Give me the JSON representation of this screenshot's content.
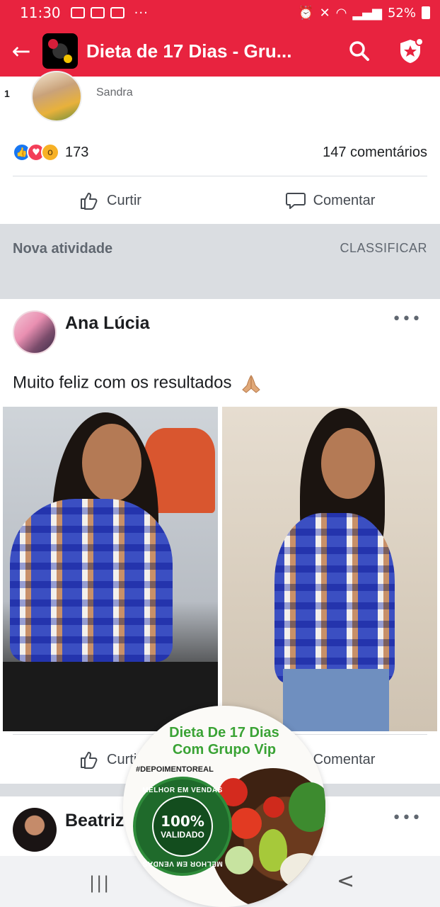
{
  "status_bar": {
    "time": "11:30",
    "battery": "52%"
  },
  "app_bar": {
    "title": "Dieta de 17 Dias - Gru..."
  },
  "previous_post": {
    "rank": "1",
    "author": "Sandra",
    "reaction_count": "173",
    "comments": "147 comentários",
    "like_label": "Curtir",
    "comment_label": "Comentar"
  },
  "section": {
    "title": "Nova atividade",
    "sort_label": "CLASSIFICAR"
  },
  "post": {
    "author": "Ana Lúcia",
    "text": "Muito feliz com os resultados",
    "like_label": "Curtir",
    "comment_label": "Comentar"
  },
  "next_post": {
    "author": "Beatriz"
  },
  "promo": {
    "title_line1": "Dieta De 17 Dias",
    "title_line2": "Com Grupo Vip",
    "hashtag": "#DEPOIMENTOREAL",
    "seal_top": "MELHOR EM VENDAS",
    "seal_percent": "100%",
    "seal_label": "VALIDADO",
    "seal_bottom": "MELHOR EM VENDAS"
  },
  "colors": {
    "brand": "#e8233f",
    "like": "#1877f2",
    "love": "#f33e58",
    "wow": "#f7b125",
    "promo_green": "#3aa335"
  }
}
